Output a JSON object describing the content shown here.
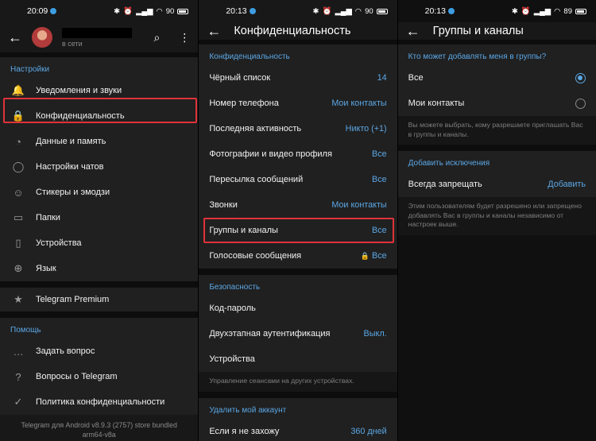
{
  "status": [
    {
      "time": "20:09",
      "battery": "90"
    },
    {
      "time": "20:13",
      "battery": "90"
    },
    {
      "time": "20:13",
      "battery": "89"
    }
  ],
  "settings": {
    "online": "в сети",
    "section_title": "Настройки",
    "items": [
      {
        "label": "Уведомления и звуки",
        "icon": "bell-icon",
        "glyph": "🔔"
      },
      {
        "label": "Конфиденциальность",
        "icon": "lock-icon",
        "glyph": "🔒"
      },
      {
        "label": "Данные и память",
        "icon": "pie-chart-icon",
        "glyph": "◔"
      },
      {
        "label": "Настройки чатов",
        "icon": "chat-bubble-icon",
        "glyph": "◯"
      },
      {
        "label": "Стикеры и эмодзи",
        "icon": "sticker-icon",
        "glyph": "☺"
      },
      {
        "label": "Папки",
        "icon": "folder-icon",
        "glyph": "▭"
      },
      {
        "label": "Устройства",
        "icon": "devices-icon",
        "glyph": "▯"
      },
      {
        "label": "Язык",
        "icon": "globe-icon",
        "glyph": "⊕"
      }
    ],
    "premium": "Telegram Premium",
    "help_title": "Помощь",
    "help_items": [
      {
        "label": "Задать вопрос",
        "icon": "chat-dots-icon",
        "glyph": "…"
      },
      {
        "label": "Вопросы о Telegram",
        "icon": "question-icon",
        "glyph": "?"
      },
      {
        "label": "Политика конфиденциальности",
        "icon": "shield-check-icon",
        "glyph": "✓"
      }
    ],
    "footer": "Telegram для Android v8.9.3 (2757) store bundled arm64-v8a"
  },
  "privacy": {
    "title": "Конфиденциальность",
    "section1": "Конфиденциальность",
    "rows": [
      {
        "label": "Чёрный список",
        "value": "14"
      },
      {
        "label": "Номер телефона",
        "value": "Мои контакты"
      },
      {
        "label": "Последняя активность",
        "value": "Никто (+1)"
      },
      {
        "label": "Фотографии и видео профиля",
        "value": "Все"
      },
      {
        "label": "Пересылка сообщений",
        "value": "Все"
      },
      {
        "label": "Звонки",
        "value": "Мои контакты"
      },
      {
        "label": "Группы и каналы",
        "value": "Все"
      },
      {
        "label": "Голосовые сообщения",
        "value": "Все"
      }
    ],
    "section2": "Безопасность",
    "security_rows": [
      {
        "label": "Код-пароль",
        "value": ""
      },
      {
        "label": "Двухэтапная аутентификация",
        "value": "Выкл."
      },
      {
        "label": "Устройства",
        "value": ""
      }
    ],
    "security_hint": "Управление сеансами на других устройствах.",
    "section3": "Удалить мой аккаунт",
    "delete_row": {
      "label": "Если я не захожу",
      "value": "360 дней"
    }
  },
  "groups": {
    "title": "Группы и каналы",
    "question": "Кто может добавлять меня в группы?",
    "options": [
      {
        "label": "Все",
        "selected": true
      },
      {
        "label": "Мои контакты",
        "selected": false
      }
    ],
    "hint1": "Вы можете выбрать, кому разрешаете приглашать Вас в группы и каналы.",
    "exceptions_title": "Добавить исключения",
    "always_deny": "Всегда запрещать",
    "add": "Добавить",
    "hint2": "Этим пользователям будет разрешено или запрещено добавлять Вас в группы и каналы независимо от настроек выше."
  },
  "colors": {
    "accent": "#5ba7e5",
    "highlight": "#e0323a",
    "premium": "#8e6cf2"
  }
}
